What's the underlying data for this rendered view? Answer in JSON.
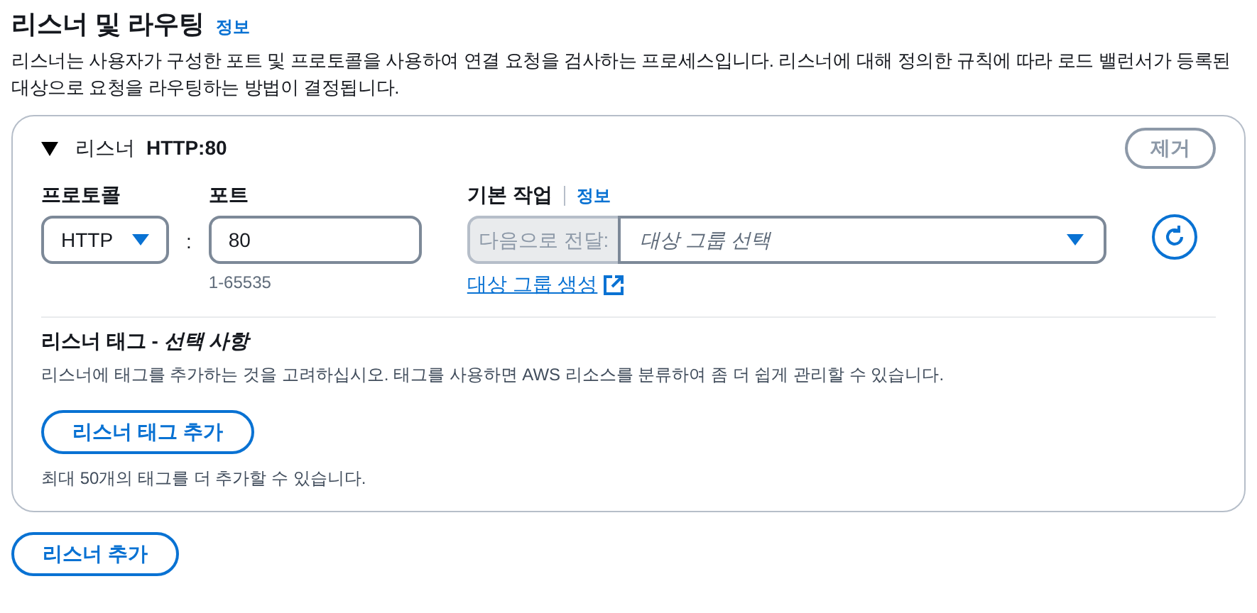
{
  "section": {
    "title": "리스너 및 라우팅",
    "info_link": "정보",
    "description": "리스너는 사용자가 구성한 포트 및 프로토콜을 사용하여 연결 요청을 검사하는 프로세스입니다. 리스너에 대해 정의한 규칙에 따라 로드 밸런서가 등록된 대상으로 요청을 라우팅하는 방법이 결정됩니다."
  },
  "listener": {
    "expanded": true,
    "label": "리스너",
    "name": "HTTP:80",
    "remove_button": {
      "label": "제거",
      "disabled": true
    },
    "protocol": {
      "label": "프로토콜",
      "value": "HTTP"
    },
    "separator": ":",
    "port": {
      "label": "포트",
      "value": "80",
      "hint": "1-65535"
    },
    "default_action": {
      "label": "기본 작업",
      "info_link": "정보",
      "prefix": "다음으로 전달:",
      "placeholder": "대상 그룹 선택",
      "create_link": "대상 그룹 생성"
    },
    "tags": {
      "title": "리스너 태그 - *선택 사항*",
      "description": "리스너에 태그를 추가하는 것을 고려하십시오. 태그를 사용하면 AWS 리소스를 분류하여 좀 더 쉽게 관리할 수 있습니다.",
      "add_button": "리스너 태그 추가",
      "limit_note": "최대 50개의 태그를 더 추가할 수 있습니다."
    }
  },
  "add_listener_button": "리스너 추가"
}
